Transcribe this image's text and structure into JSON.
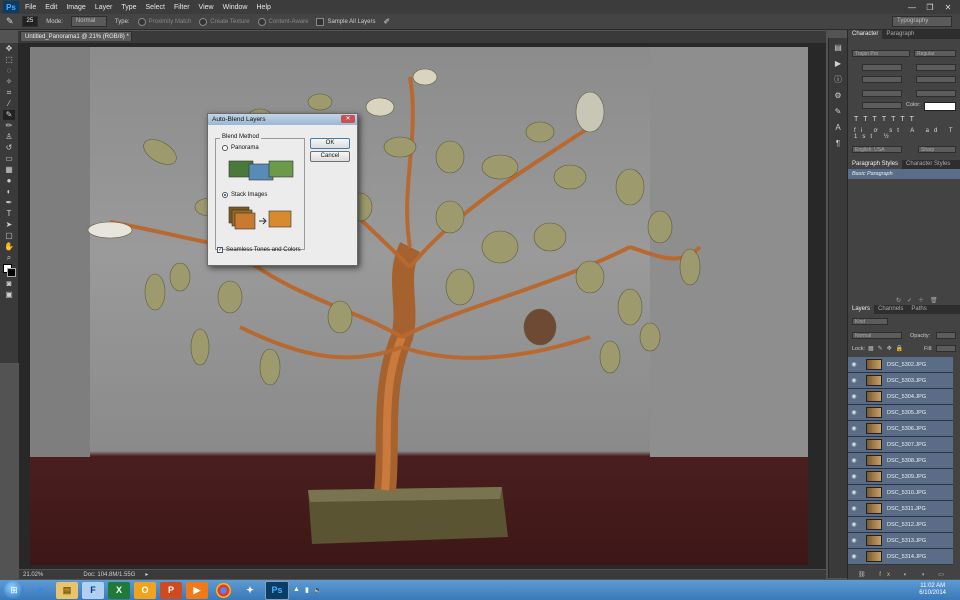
{
  "app": {
    "logo": "Ps"
  },
  "menu": [
    "File",
    "Edit",
    "Image",
    "Layer",
    "Type",
    "Select",
    "Filter",
    "View",
    "Window",
    "Help"
  ],
  "window_controls": [
    "—",
    "❐",
    "✕"
  ],
  "options_bar": {
    "brush_size": "25",
    "mode_label": "Mode:",
    "mode_value": "Normal",
    "type_label": "Type:",
    "proximity_match": "Proximity Match",
    "create_texture": "Create Texture",
    "content_aware": "Content-Aware",
    "sample_all_layers": "Sample All Layers",
    "workspace": "Typography"
  },
  "document": {
    "tab_title": "Untitled_Panorama1 @ 21% (RGB/8) *",
    "zoom": "21.02%",
    "doc_size": "Doc: 104.8M/1.55G"
  },
  "dialog": {
    "title": "Auto-Blend Layers",
    "group_label": "Blend Method",
    "option_panorama": "Panorama",
    "option_stack": "Stack Images",
    "selected": "Stack Images",
    "seamless_label": "Seamless Tones and Colors",
    "ok": "OK",
    "cancel": "Cancel"
  },
  "character_panel": {
    "tabs": [
      "Character",
      "Paragraph"
    ],
    "font_family": "Trajan Pro",
    "font_style": "Regular",
    "language": "English: USA",
    "antialias": "Sharp",
    "color_label": "Color:"
  },
  "paragraph_styles": {
    "tabs": [
      "Paragraph Styles",
      "Character Styles"
    ],
    "items": [
      "Basic Paragraph"
    ]
  },
  "layers_panel": {
    "tabs": [
      "Layers",
      "Channels",
      "Paths"
    ],
    "kind": "Kind",
    "blend_mode": "Normal",
    "opacity_label": "Opacity:",
    "lock_label": "Lock:",
    "fill_label": "Fill:",
    "layers": [
      "DSC_5302.JPG",
      "DSC_5303.JPG",
      "DSC_5304.JPG",
      "DSC_5305.JPG",
      "DSC_5306.JPG",
      "DSC_5307.JPG",
      "DSC_5308.JPG",
      "DSC_5309.JPG",
      "DSC_5310.JPG",
      "DSC_5311.JPG",
      "DSC_5312.JPG",
      "DSC_5313.JPG",
      "DSC_5314.JPG"
    ]
  },
  "taskbar": {
    "time": "11:02 AM",
    "date": "6/10/2014"
  },
  "colors": {
    "selection": "#5a6d86",
    "accent": "#3a79b9"
  }
}
